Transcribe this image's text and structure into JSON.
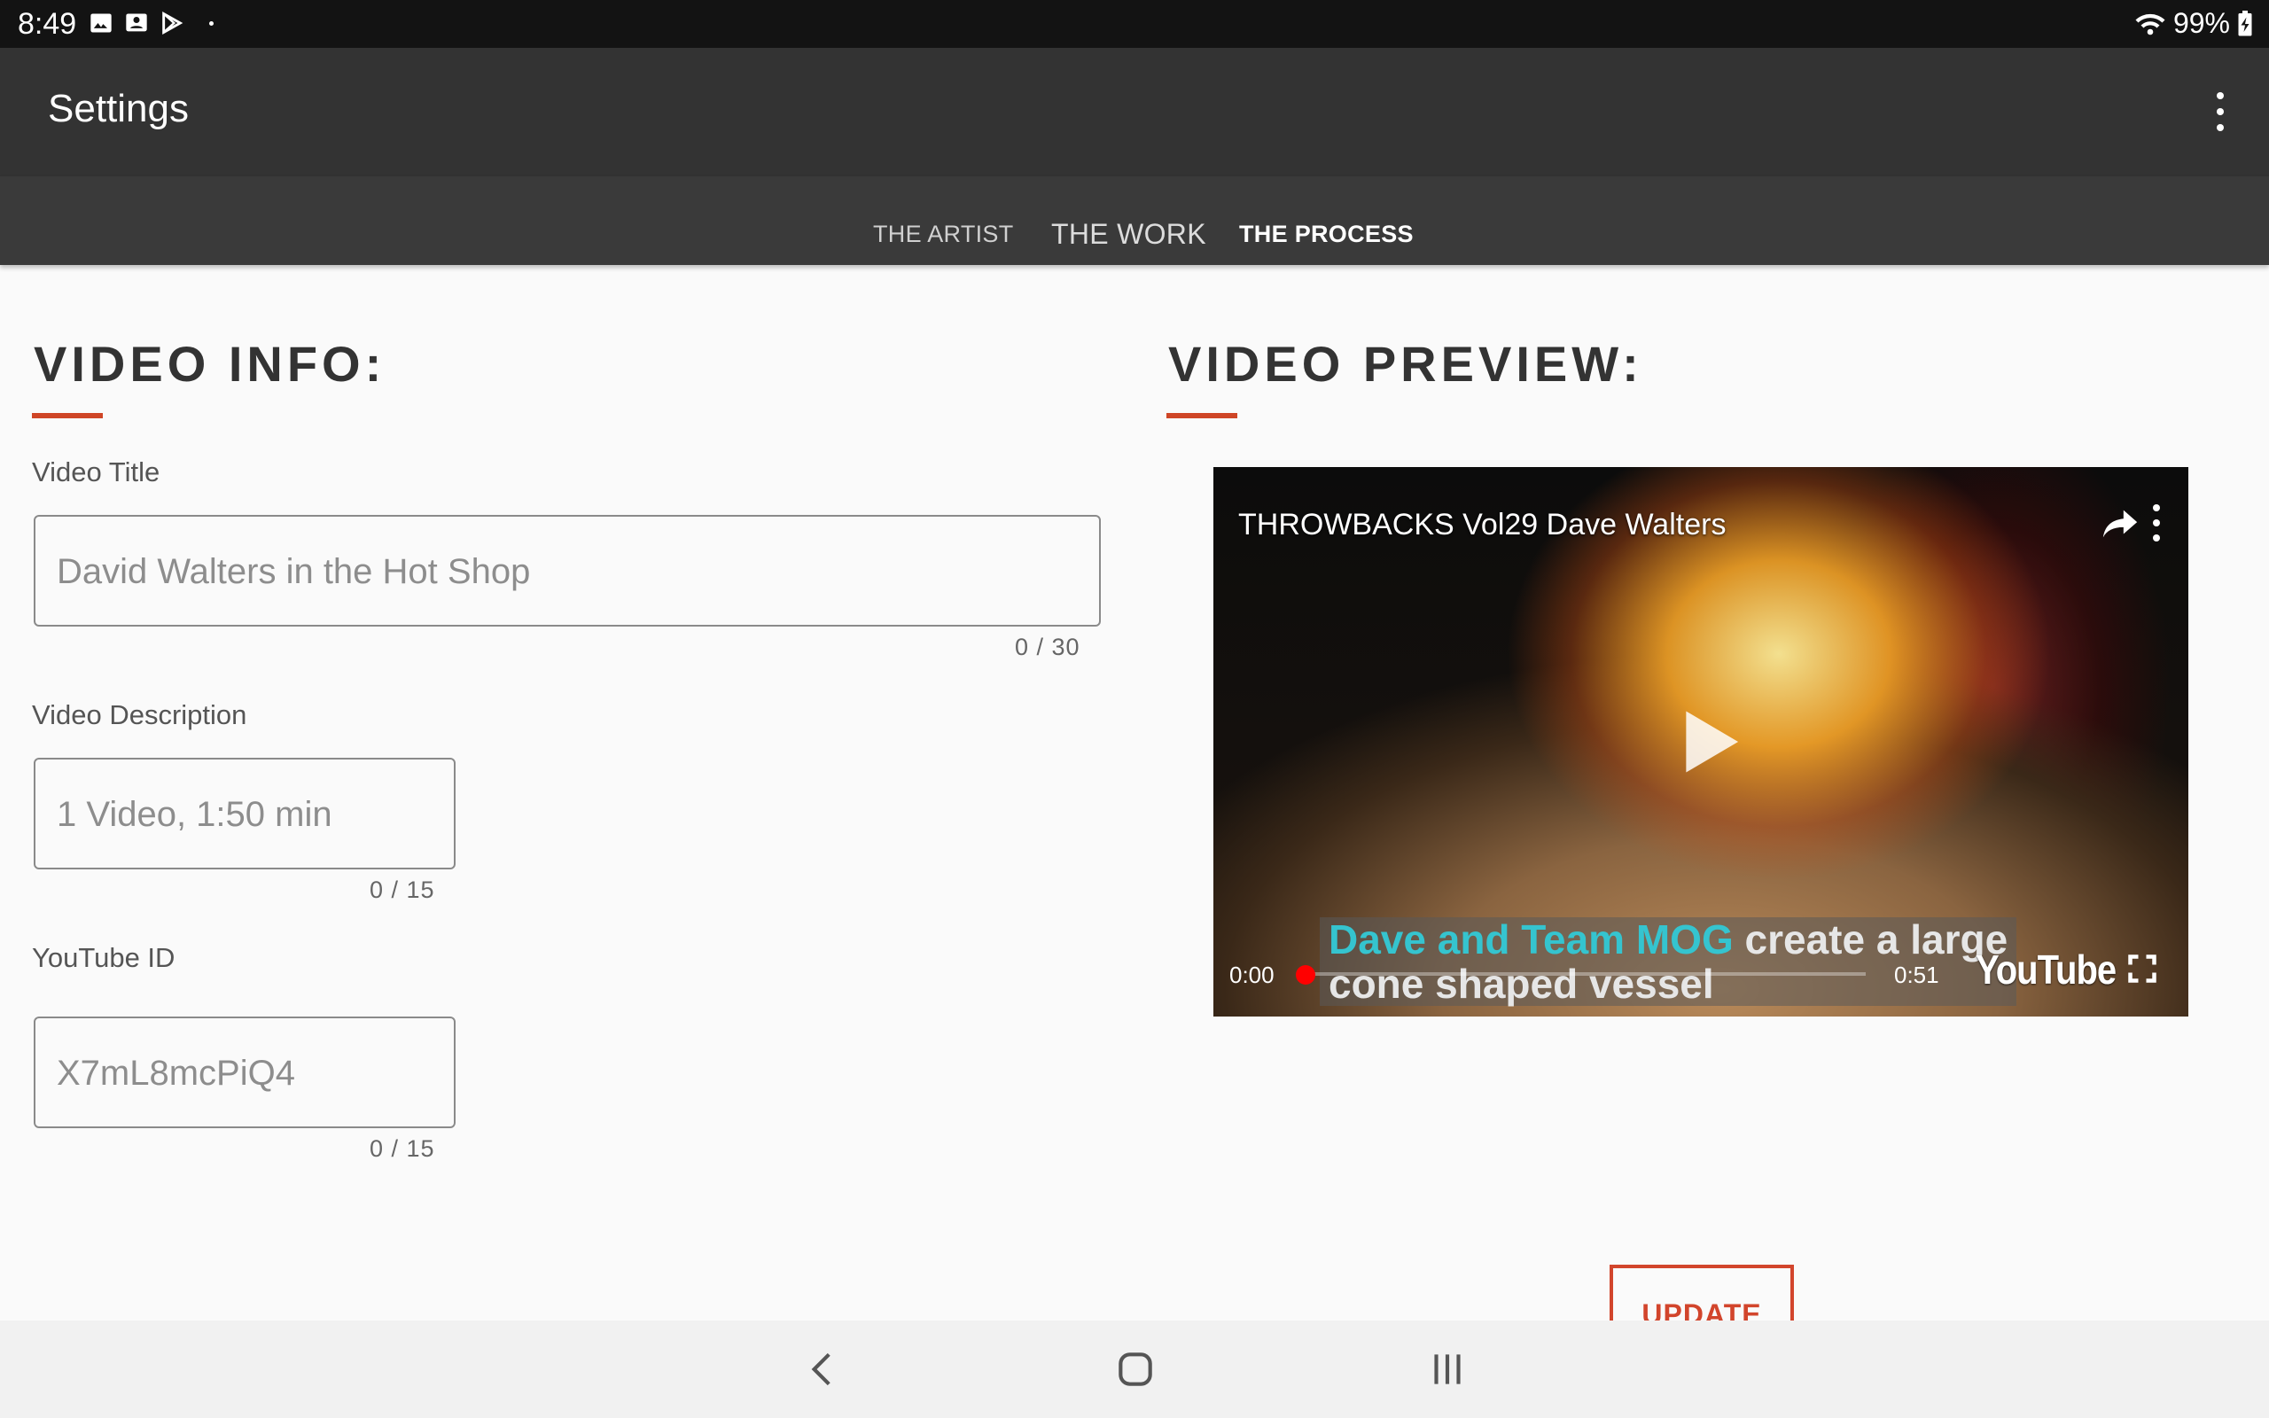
{
  "status_bar": {
    "time": "8:49",
    "notification_icons": [
      "gallery-icon",
      "contact-card-icon",
      "play-store-icon"
    ],
    "battery": "99%"
  },
  "app_bar": {
    "title": "Settings"
  },
  "tabs": [
    {
      "label": "THE ARTIST"
    },
    {
      "label": "THE WORK"
    },
    {
      "label": "THE PROCESS",
      "selected": true
    }
  ],
  "video_info": {
    "heading": "VIDEO INFO:",
    "fields": [
      {
        "label": "Video Title",
        "value": "David Walters in the Hot Shop",
        "counter": "0 / 30"
      },
      {
        "label": "Video Description",
        "value": "1 Video, 1:50 min",
        "counter": "0 / 15"
      },
      {
        "label": "YouTube ID",
        "value": "X7mL8mcPiQ4",
        "counter": "0 / 15"
      }
    ]
  },
  "video_preview": {
    "heading": "VIDEO PREVIEW:",
    "title": "THROWBACKS Vol29 Dave Walters",
    "caption_highlight": "Dave and Team MOG",
    "caption_rest": " create a large",
    "caption_line2": "cone shaped vessel",
    "time_current": "0:00",
    "time_total": "0:51",
    "progress_fraction": 0.0,
    "brand": "YouTube"
  },
  "actions": {
    "update_label": "UPDATE"
  },
  "colors": {
    "accent": "#cf4526",
    "appbar": "#333333",
    "tabbar": "#3a3a3a"
  }
}
